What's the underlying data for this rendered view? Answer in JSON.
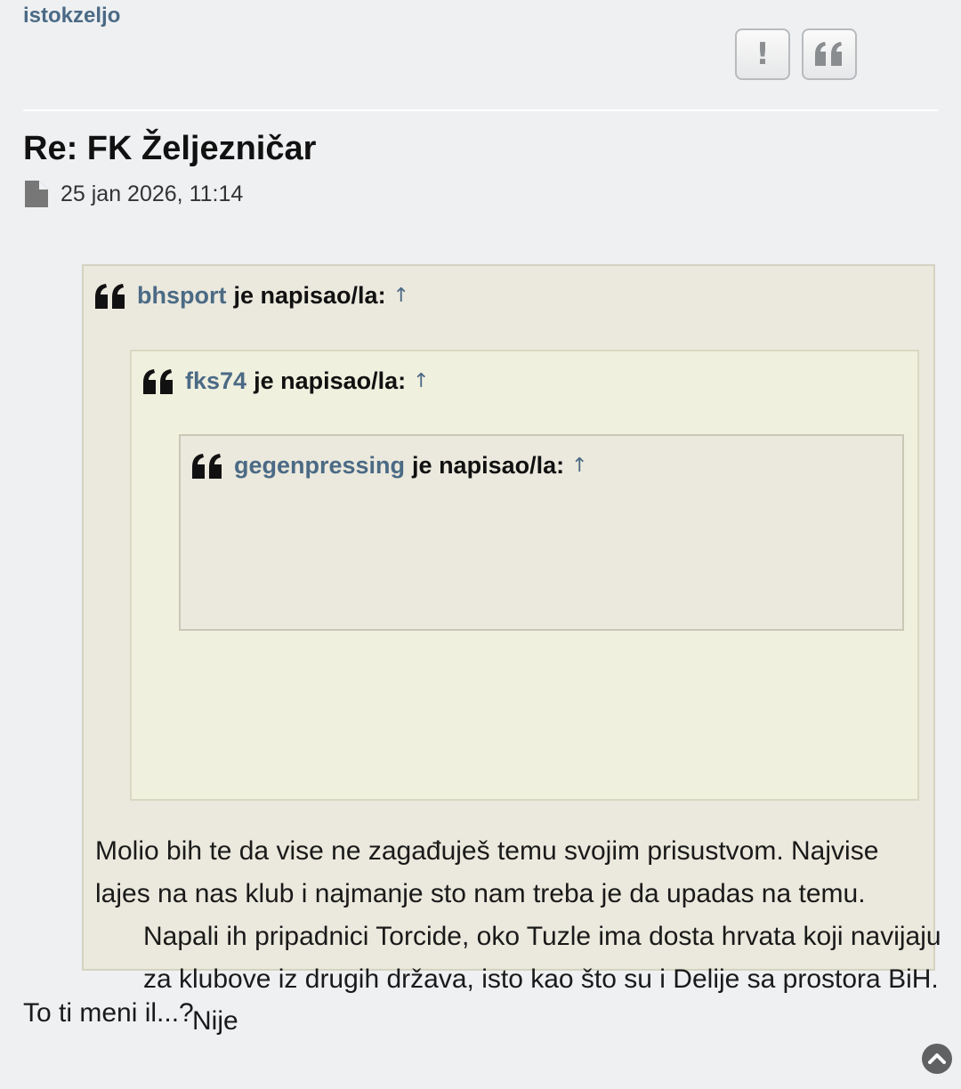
{
  "post": {
    "author": "istokzeljo",
    "title": "Re: FK Željezničar",
    "date": "25 jan 2026, 11:14",
    "reply_text": "To ti meni il...?"
  },
  "actions": {
    "report_icon": "exclamation-icon",
    "quote_icon": "quote-icon"
  },
  "quotes": {
    "level1": {
      "author": "bhsport",
      "wrote": "je napisao/la:",
      "arrow": "↑",
      "text": "Molio bih te da vise ne zagađuješ temu svojim prisustvom. Najvise lajes na nas klub i najmanje sto nam treba je da upadas na temu."
    },
    "level2": {
      "author": "fks74",
      "wrote": "je napisao/la:",
      "arrow": "↑",
      "text": "Napali ih pripadnici Torcide, oko Tuzle ima dosta hrvata koji navijaju za klubove iz drugih država, isto kao što su i Delije sa prostora BiH."
    },
    "level3": {
      "author": "gegenpressing",
      "wrote": "je napisao/la:",
      "arrow": "↑",
      "text": "Nije"
    }
  },
  "colors": {
    "link": "#4b6a85",
    "background": "#eef0f2",
    "quote_bg_outer": "#ebe9dd",
    "quote_bg_inner": "#f0f0df"
  }
}
